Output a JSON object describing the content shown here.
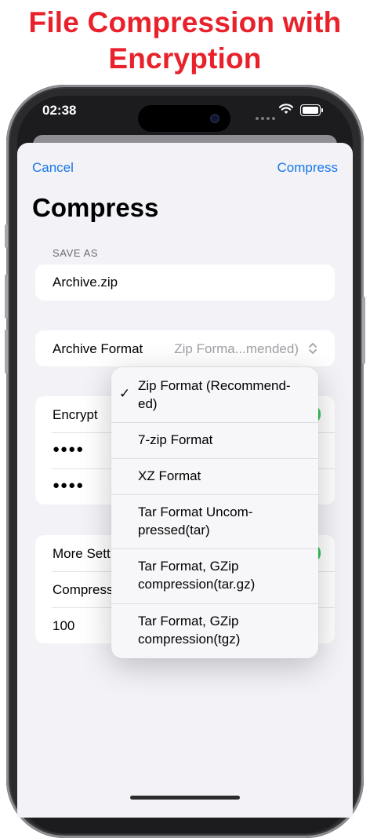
{
  "headline": {
    "line1": "File Compression with",
    "line2": "Encryption"
  },
  "status_bar": {
    "time": "02:38",
    "icons": [
      "signal-dots-icon",
      "wifi-icon",
      "battery-icon"
    ]
  },
  "nav": {
    "cancel_label": "Cancel",
    "compress_label": "Compress",
    "title": "Compress"
  },
  "save_as": {
    "header": "SAVE AS",
    "filename": "Archive.zip"
  },
  "archive_format": {
    "label": "Archive Format",
    "value": "Zip Forma...mended)",
    "options": [
      {
        "line1": "Zip Format (Recommend-",
        "line2": "ed)",
        "selected": true
      },
      {
        "line1": "7-zip Format",
        "line2": "",
        "selected": false
      },
      {
        "line1": "XZ Format",
        "line2": "",
        "selected": false
      },
      {
        "line1": "Tar Format Uncom-",
        "line2": "pressed(tar)",
        "selected": false
      },
      {
        "line1": "Tar Format, GZip",
        "line2": "compression(tar.gz)",
        "selected": false
      },
      {
        "line1": "Tar Format, GZip",
        "line2": "compression(tgz)",
        "selected": false
      }
    ]
  },
  "encryption": {
    "encrypt_label": "Encrypt",
    "password": "●●●●",
    "confirm_password": "●●●●"
  },
  "more_settings": {
    "more_label": "More Sett",
    "compression_label": "Compress",
    "level_value": "100"
  },
  "colors": {
    "accent": "#1877e8",
    "headline": "#e8212b",
    "toggle_on": "#34c759"
  }
}
